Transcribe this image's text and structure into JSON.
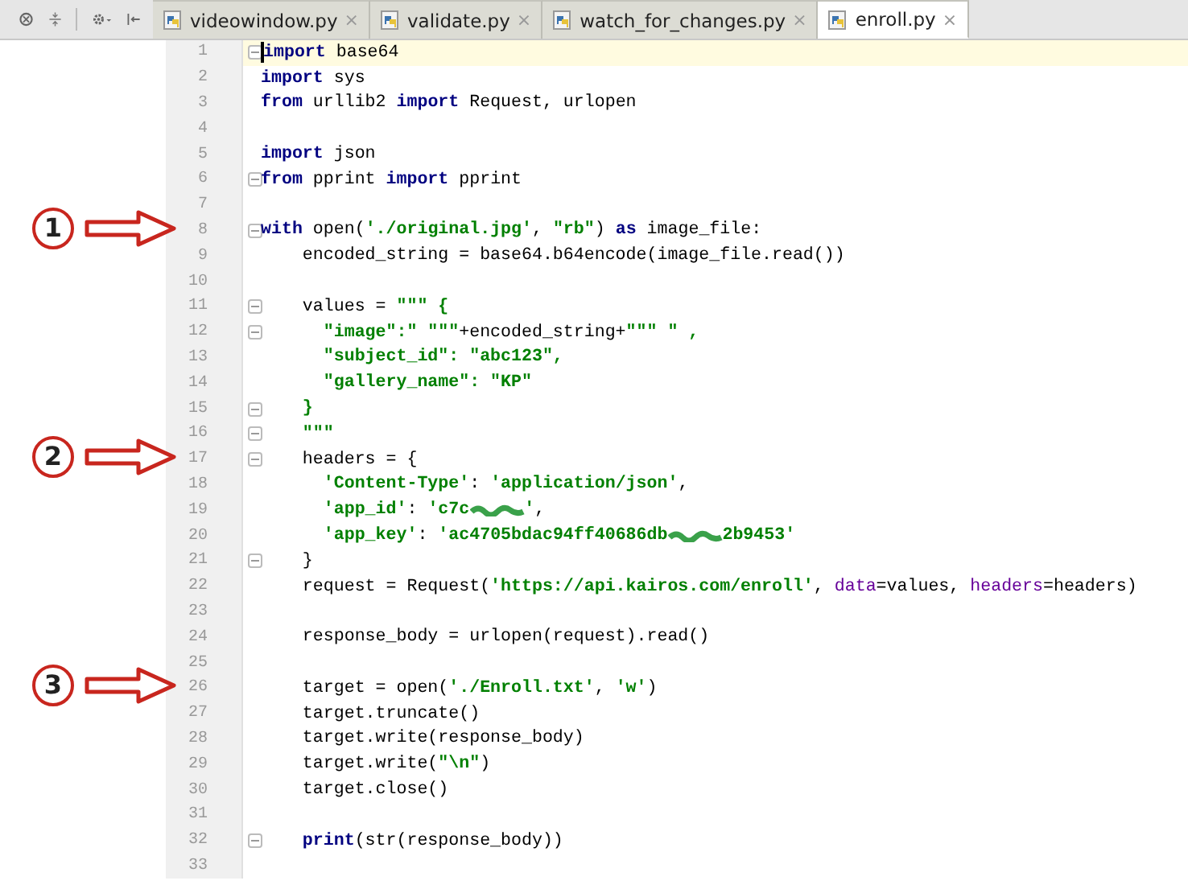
{
  "tabs": [
    {
      "label": "videowindow.py",
      "close": "×",
      "selected": false
    },
    {
      "label": "validate.py",
      "close": "×",
      "selected": false
    },
    {
      "label": "watch_for_changes.py",
      "close": "×",
      "selected": false
    },
    {
      "label": "enroll.py",
      "close": "×",
      "selected": true
    }
  ],
  "editor": {
    "lines": [
      {
        "number": "1",
        "current": true,
        "fold": true,
        "tokens": [
          {
            "kind": "keyword",
            "text": "import"
          },
          {
            "kind": "plain",
            "text": " base64"
          }
        ]
      },
      {
        "number": "2",
        "current": false,
        "fold": false,
        "tokens": [
          {
            "kind": "keyword",
            "text": "import"
          },
          {
            "kind": "plain",
            "text": " sys"
          }
        ]
      },
      {
        "number": "3",
        "current": false,
        "fold": false,
        "tokens": [
          {
            "kind": "keyword",
            "text": "from"
          },
          {
            "kind": "plain",
            "text": " urllib2 "
          },
          {
            "kind": "keyword",
            "text": "import"
          },
          {
            "kind": "plain",
            "text": " Request, urlopen"
          }
        ]
      },
      {
        "number": "4",
        "current": false,
        "fold": false
      },
      {
        "number": "5",
        "current": false,
        "fold": false,
        "tokens": [
          {
            "kind": "keyword",
            "text": "import"
          },
          {
            "kind": "plain",
            "text": " json"
          }
        ]
      },
      {
        "number": "6",
        "current": false,
        "fold": true,
        "tokens": [
          {
            "kind": "keyword",
            "text": "from"
          },
          {
            "kind": "plain",
            "text": " pprint "
          },
          {
            "kind": "keyword",
            "text": "import"
          },
          {
            "kind": "plain",
            "text": " pprint"
          }
        ]
      },
      {
        "number": "7",
        "current": false,
        "fold": false
      },
      {
        "number": "8",
        "current": false,
        "fold": true,
        "marker": "1",
        "tokens": [
          {
            "kind": "keyword",
            "text": "with"
          },
          {
            "kind": "plain",
            "text": " open("
          },
          {
            "kind": "string",
            "text": "'./original.jpg'"
          },
          {
            "kind": "plain",
            "text": ", "
          },
          {
            "kind": "string",
            "text": "\"rb\""
          },
          {
            "kind": "plain",
            "text": ") "
          },
          {
            "kind": "keyword",
            "text": "as"
          },
          {
            "kind": "plain",
            "text": " image_file:"
          }
        ]
      },
      {
        "number": "9",
        "current": false,
        "fold": false,
        "tokens": [
          {
            "kind": "plain",
            "text": "    encoded_string = base64.b64encode(image_file.read())"
          }
        ]
      },
      {
        "number": "10",
        "current": false,
        "fold": false
      },
      {
        "number": "11",
        "current": false,
        "fold": true,
        "tokens": [
          {
            "kind": "plain",
            "text": "    values = "
          },
          {
            "kind": "string",
            "text": "\"\"\" {"
          }
        ]
      },
      {
        "number": "12",
        "current": false,
        "fold": true,
        "tokens": [
          {
            "kind": "string",
            "text": "      \"image\":\" \"\"\""
          },
          {
            "kind": "plain",
            "text": "+encoded_string+"
          },
          {
            "kind": "string",
            "text": "\"\"\" \" ,"
          }
        ]
      },
      {
        "number": "13",
        "current": false,
        "fold": false,
        "tokens": [
          {
            "kind": "string",
            "text": "      \"subject_id\": \"abc123\","
          }
        ]
      },
      {
        "number": "14",
        "current": false,
        "fold": false,
        "tokens": [
          {
            "kind": "string",
            "text": "      \"gallery_name\": \"KP\""
          }
        ]
      },
      {
        "number": "15",
        "current": false,
        "fold": true,
        "tokens": [
          {
            "kind": "string",
            "text": "    }"
          }
        ]
      },
      {
        "number": "16",
        "current": false,
        "fold": true,
        "tokens": [
          {
            "kind": "string",
            "text": "    \"\"\""
          }
        ]
      },
      {
        "number": "17",
        "current": false,
        "fold": true,
        "marker": "2",
        "tokens": [
          {
            "kind": "plain",
            "text": "    headers = {"
          }
        ]
      },
      {
        "number": "18",
        "current": false,
        "fold": false,
        "tokens": [
          {
            "kind": "string",
            "text": "      'Content-Type'"
          },
          {
            "kind": "plain",
            "text": ": "
          },
          {
            "kind": "string",
            "text": "'application/json'"
          },
          {
            "kind": "plain",
            "text": ","
          }
        ]
      },
      {
        "number": "19",
        "current": false,
        "fold": false,
        "tokens": [
          {
            "kind": "string",
            "text": "      'app_id'"
          },
          {
            "kind": "plain",
            "text": ": "
          },
          {
            "kind": "string",
            "text": "'c7c"
          },
          {
            "kind": "redacted"
          },
          {
            "kind": "string",
            "text": "'"
          },
          {
            "kind": "plain",
            "text": ","
          }
        ]
      },
      {
        "number": "20",
        "current": false,
        "fold": false,
        "tokens": [
          {
            "kind": "string",
            "text": "      'app_key'"
          },
          {
            "kind": "plain",
            "text": ": "
          },
          {
            "kind": "string",
            "text": "'ac4705bdac94ff40686db"
          },
          {
            "kind": "redacted"
          },
          {
            "kind": "string",
            "text": "2b9453'"
          }
        ]
      },
      {
        "number": "21",
        "current": false,
        "fold": true,
        "tokens": [
          {
            "kind": "plain",
            "text": "    }"
          }
        ]
      },
      {
        "number": "22",
        "current": false,
        "fold": false,
        "tokens": [
          {
            "kind": "plain",
            "text": "    request = Request("
          },
          {
            "kind": "string",
            "text": "'https://api.kairos.com/enroll'"
          },
          {
            "kind": "plain",
            "text": ", "
          },
          {
            "kind": "param",
            "text": "data"
          },
          {
            "kind": "plain",
            "text": "=values, "
          },
          {
            "kind": "param",
            "text": "headers"
          },
          {
            "kind": "plain",
            "text": "=headers)"
          }
        ]
      },
      {
        "number": "23",
        "current": false,
        "fold": false
      },
      {
        "number": "24",
        "current": false,
        "fold": false,
        "tokens": [
          {
            "kind": "plain",
            "text": "    response_body = urlopen(request).read()"
          }
        ]
      },
      {
        "number": "25",
        "current": false,
        "fold": false
      },
      {
        "number": "26",
        "current": false,
        "fold": false,
        "marker": "3",
        "tokens": [
          {
            "kind": "plain",
            "text": "    target = open("
          },
          {
            "kind": "string",
            "text": "'./Enroll.txt'"
          },
          {
            "kind": "plain",
            "text": ", "
          },
          {
            "kind": "string",
            "text": "'w'"
          },
          {
            "kind": "plain",
            "text": ")"
          }
        ]
      },
      {
        "number": "27",
        "current": false,
        "fold": false,
        "tokens": [
          {
            "kind": "plain",
            "text": "    target.truncate()"
          }
        ]
      },
      {
        "number": "28",
        "current": false,
        "fold": false,
        "tokens": [
          {
            "kind": "plain",
            "text": "    target.write(response_body)"
          }
        ]
      },
      {
        "number": "29",
        "current": false,
        "fold": false,
        "tokens": [
          {
            "kind": "plain",
            "text": "    target.write("
          },
          {
            "kind": "string",
            "text": "\"\\n\""
          },
          {
            "kind": "plain",
            "text": ")"
          }
        ]
      },
      {
        "number": "30",
        "current": false,
        "fold": false,
        "tokens": [
          {
            "kind": "plain",
            "text": "    target.close()"
          }
        ]
      },
      {
        "number": "31",
        "current": false,
        "fold": false
      },
      {
        "number": "32",
        "current": false,
        "fold": true,
        "tokens": [
          {
            "kind": "keyword",
            "text": "    print"
          },
          {
            "kind": "plain",
            "text": "(str(response_body))"
          }
        ]
      },
      {
        "number": "33",
        "current": false,
        "fold": false
      }
    ]
  }
}
